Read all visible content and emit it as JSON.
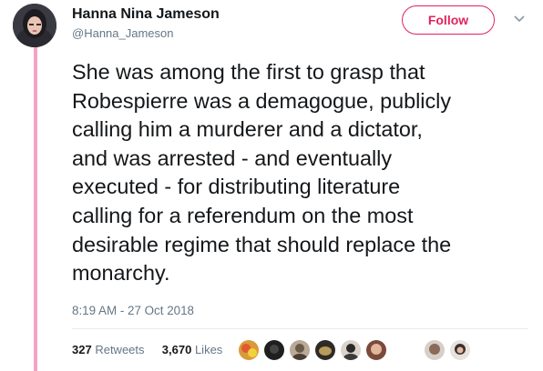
{
  "author": {
    "display_name": "Hanna Nina Jameson",
    "handle": "@Hanna_Jameson",
    "avatar_icon": "profile-photo"
  },
  "follow_button": {
    "label": "Follow",
    "color": "#e0245e"
  },
  "thread_line_color": "#f4a3c4",
  "tweet": {
    "lines": [
      "She was among the first to grasp that",
      "Robespierre was a demagogue, publicly",
      "calling him a murderer and a dictator,",
      "and was arrested - and eventually",
      "executed - for distributing literature",
      "calling for a referendum on the most",
      "desirable regime that should replace the",
      "monarchy."
    ],
    "timestamp": "8:19 AM - 27 Oct 2018"
  },
  "stats": {
    "retweets_count": "327",
    "retweets_label": "Retweets",
    "likes_count": "3,670",
    "likes_label": "Likes"
  },
  "likers": [
    {
      "icon": "liker-avatar-1",
      "color": "#c98a3a"
    },
    {
      "icon": "liker-avatar-2",
      "color": "#2a2a2a"
    },
    {
      "icon": "liker-avatar-3",
      "color": "#8a7a68"
    },
    {
      "icon": "liker-avatar-4",
      "color": "#5b5248"
    },
    {
      "icon": "liker-avatar-5",
      "color": "#6d6d6d"
    },
    {
      "icon": "liker-avatar-6",
      "color": "#b5826a"
    },
    {
      "icon": "liker-avatar-7",
      "color": "#9a8a80"
    },
    {
      "icon": "liker-avatar-8",
      "color": "#7a6d66"
    }
  ]
}
